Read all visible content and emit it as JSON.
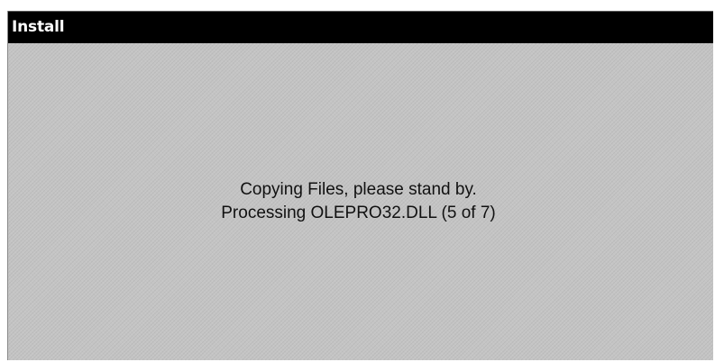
{
  "window": {
    "title": "Install"
  },
  "status": {
    "line1": "Copying Files, please stand by.",
    "line2": "Processing OLEPRO32.DLL (5 of 7)"
  },
  "colors": {
    "titlebar": "#000000",
    "title_text": "#ffffff",
    "window_background": "#c4c4c4",
    "message_text": "#111111"
  }
}
